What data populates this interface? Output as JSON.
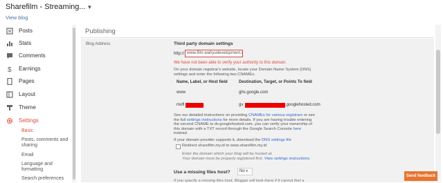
{
  "header": {
    "blog_title": "Sharefilm - Streaming...",
    "view_blog": "View blog"
  },
  "sidebar": {
    "items": [
      {
        "label": "Posts",
        "icon": "posts-icon"
      },
      {
        "label": "Stats",
        "icon": "stats-icon"
      },
      {
        "label": "Comments",
        "icon": "comments-icon"
      },
      {
        "label": "Earnings",
        "icon": "earnings-icon"
      },
      {
        "label": "Pages",
        "icon": "pages-icon"
      },
      {
        "label": "Layout",
        "icon": "layout-icon"
      },
      {
        "label": "Theme",
        "icon": "theme-icon"
      },
      {
        "label": "Settings",
        "icon": "settings-gear-icon",
        "active": true
      }
    ],
    "sub_items": [
      "Basic",
      "Posts, comments and sharing",
      "Email",
      "Language and formatting",
      "Search preferences"
    ]
  },
  "main": {
    "section_title": "Publishing",
    "row_label": "Blog Address",
    "third_party_title": "Third party domain settings",
    "http_prefix": "http://",
    "domain_input_value": "www.film.wahyudevelopment.c",
    "error_text": "We have not been able to verify your authority to this domain.",
    "instructions_text": "On your domain registrar's website, locate your Domain Name System (DNS) settings and enter the following two CNAMEs.",
    "col_name_header": "Name, Label, or Host field",
    "col_dest_header": "Destination, Target, or Points To field",
    "rows": [
      {
        "name": "www",
        "destination": "ghs.google.com"
      },
      {
        "name": "mofl",
        "name_suffix": ".",
        "destination": "gv",
        "destination_suffix": ".googlehosted.com"
      }
    ],
    "detail_text_1": "See our detailed instructions on providing",
    "cname_link": "CNAMEs for various registrars",
    "detail_text_2": "or see the full",
    "settings_link": "settings instructions",
    "detail_text_3": "for more details. If you are having trouble entering the second CNAME to dv.googlehosted.com, you can verify your ownership of this domain with a TXT record through the Google Search Console",
    "here_link": "here",
    "detail_text_4": "instead.",
    "dns_text": "If your domain provider supports it, download the",
    "dns_link": "DNS settings file",
    "redirect_label": "Redirect sharefilm.my.id to www.sharefilm.my.id",
    "hosted_note": "Enter the domain which your blog will be hosted at.",
    "registered_note_1": "Your domain must be properly registered first.",
    "registered_note_link": "View settings instructions.",
    "missing_files_label": "Use a missing files host?",
    "missing_files_value": "No",
    "missing_files_note": "If you specify a missing files host, Blogger will look there if it cannot find a"
  },
  "feedback_button": "Send feedback",
  "colors": {
    "accent": "#dd4b39",
    "link": "#3366cc",
    "feedback": "#e8742f",
    "redaction": "#ee0000"
  }
}
